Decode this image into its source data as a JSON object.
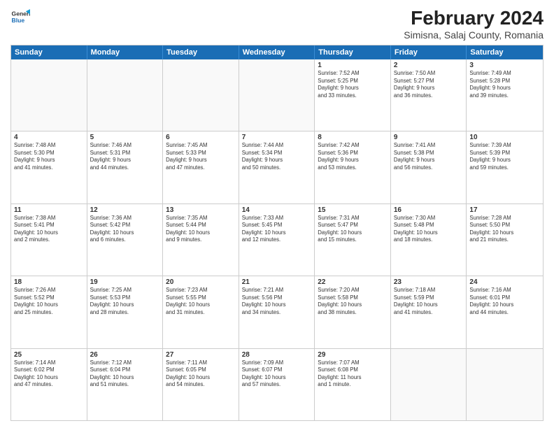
{
  "logo": {
    "line1": "General",
    "line2": "Blue"
  },
  "title": "February 2024",
  "subtitle": "Simisna, Salaj County, Romania",
  "weekdays": [
    "Sunday",
    "Monday",
    "Tuesday",
    "Wednesday",
    "Thursday",
    "Friday",
    "Saturday"
  ],
  "rows": [
    [
      {
        "day": "",
        "info": ""
      },
      {
        "day": "",
        "info": ""
      },
      {
        "day": "",
        "info": ""
      },
      {
        "day": "",
        "info": ""
      },
      {
        "day": "1",
        "info": "Sunrise: 7:52 AM\nSunset: 5:25 PM\nDaylight: 9 hours\nand 33 minutes."
      },
      {
        "day": "2",
        "info": "Sunrise: 7:50 AM\nSunset: 5:27 PM\nDaylight: 9 hours\nand 36 minutes."
      },
      {
        "day": "3",
        "info": "Sunrise: 7:49 AM\nSunset: 5:28 PM\nDaylight: 9 hours\nand 39 minutes."
      }
    ],
    [
      {
        "day": "4",
        "info": "Sunrise: 7:48 AM\nSunset: 5:30 PM\nDaylight: 9 hours\nand 41 minutes."
      },
      {
        "day": "5",
        "info": "Sunrise: 7:46 AM\nSunset: 5:31 PM\nDaylight: 9 hours\nand 44 minutes."
      },
      {
        "day": "6",
        "info": "Sunrise: 7:45 AM\nSunset: 5:33 PM\nDaylight: 9 hours\nand 47 minutes."
      },
      {
        "day": "7",
        "info": "Sunrise: 7:44 AM\nSunset: 5:34 PM\nDaylight: 9 hours\nand 50 minutes."
      },
      {
        "day": "8",
        "info": "Sunrise: 7:42 AM\nSunset: 5:36 PM\nDaylight: 9 hours\nand 53 minutes."
      },
      {
        "day": "9",
        "info": "Sunrise: 7:41 AM\nSunset: 5:38 PM\nDaylight: 9 hours\nand 56 minutes."
      },
      {
        "day": "10",
        "info": "Sunrise: 7:39 AM\nSunset: 5:39 PM\nDaylight: 9 hours\nand 59 minutes."
      }
    ],
    [
      {
        "day": "11",
        "info": "Sunrise: 7:38 AM\nSunset: 5:41 PM\nDaylight: 10 hours\nand 2 minutes."
      },
      {
        "day": "12",
        "info": "Sunrise: 7:36 AM\nSunset: 5:42 PM\nDaylight: 10 hours\nand 6 minutes."
      },
      {
        "day": "13",
        "info": "Sunrise: 7:35 AM\nSunset: 5:44 PM\nDaylight: 10 hours\nand 9 minutes."
      },
      {
        "day": "14",
        "info": "Sunrise: 7:33 AM\nSunset: 5:45 PM\nDaylight: 10 hours\nand 12 minutes."
      },
      {
        "day": "15",
        "info": "Sunrise: 7:31 AM\nSunset: 5:47 PM\nDaylight: 10 hours\nand 15 minutes."
      },
      {
        "day": "16",
        "info": "Sunrise: 7:30 AM\nSunset: 5:48 PM\nDaylight: 10 hours\nand 18 minutes."
      },
      {
        "day": "17",
        "info": "Sunrise: 7:28 AM\nSunset: 5:50 PM\nDaylight: 10 hours\nand 21 minutes."
      }
    ],
    [
      {
        "day": "18",
        "info": "Sunrise: 7:26 AM\nSunset: 5:52 PM\nDaylight: 10 hours\nand 25 minutes."
      },
      {
        "day": "19",
        "info": "Sunrise: 7:25 AM\nSunset: 5:53 PM\nDaylight: 10 hours\nand 28 minutes."
      },
      {
        "day": "20",
        "info": "Sunrise: 7:23 AM\nSunset: 5:55 PM\nDaylight: 10 hours\nand 31 minutes."
      },
      {
        "day": "21",
        "info": "Sunrise: 7:21 AM\nSunset: 5:56 PM\nDaylight: 10 hours\nand 34 minutes."
      },
      {
        "day": "22",
        "info": "Sunrise: 7:20 AM\nSunset: 5:58 PM\nDaylight: 10 hours\nand 38 minutes."
      },
      {
        "day": "23",
        "info": "Sunrise: 7:18 AM\nSunset: 5:59 PM\nDaylight: 10 hours\nand 41 minutes."
      },
      {
        "day": "24",
        "info": "Sunrise: 7:16 AM\nSunset: 6:01 PM\nDaylight: 10 hours\nand 44 minutes."
      }
    ],
    [
      {
        "day": "25",
        "info": "Sunrise: 7:14 AM\nSunset: 6:02 PM\nDaylight: 10 hours\nand 47 minutes."
      },
      {
        "day": "26",
        "info": "Sunrise: 7:12 AM\nSunset: 6:04 PM\nDaylight: 10 hours\nand 51 minutes."
      },
      {
        "day": "27",
        "info": "Sunrise: 7:11 AM\nSunset: 6:05 PM\nDaylight: 10 hours\nand 54 minutes."
      },
      {
        "day": "28",
        "info": "Sunrise: 7:09 AM\nSunset: 6:07 PM\nDaylight: 10 hours\nand 57 minutes."
      },
      {
        "day": "29",
        "info": "Sunrise: 7:07 AM\nSunset: 6:08 PM\nDaylight: 11 hours\nand 1 minute."
      },
      {
        "day": "",
        "info": ""
      },
      {
        "day": "",
        "info": ""
      }
    ]
  ]
}
